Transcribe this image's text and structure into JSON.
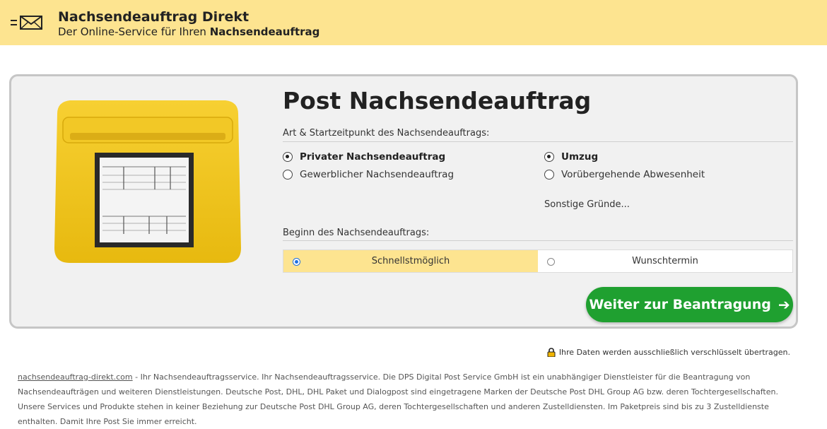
{
  "header": {
    "brand_title": "Nachsendeauftrag Direkt",
    "brand_sub_prefix": "Der Online-Service für Ihren ",
    "brand_sub_bold": "Nachsendeauftrag",
    "logo_icon": "envelope-icon",
    "background": "#fde490"
  },
  "card": {
    "title": "Post Nachsendeauftrag",
    "image": "yellow-mailbox",
    "type_section_label": "Art & Startzeitpunkt des Nachsendeauftrags:",
    "type_options": [
      {
        "label": "Privater Nachsendeauftrag",
        "selected": true
      },
      {
        "label": "Gewerblicher Nachsendeauftrag",
        "selected": false
      }
    ],
    "reason_options": [
      {
        "label": "Umzug",
        "selected": true
      },
      {
        "label": "Vorübergehende Abwesenheit",
        "selected": false
      }
    ],
    "other_reasons": "Sonstige Gründe...",
    "start_section_label": "Beginn des Nachsendeauftrags:",
    "start_options": [
      {
        "label": "Schnellstmöglich",
        "selected": true
      },
      {
        "label": "Wunschtermin",
        "selected": false
      }
    ],
    "cta_label": "Weiter zur Beantragung",
    "cta_color": "#1fa030"
  },
  "secure_note": "Ihre Daten werden ausschließlich verschlüsselt übertragen.",
  "footer": {
    "link_text": "nachsendeauftrag-direkt.com",
    "text": " - Ihr Nachsendeauftragsservice. Ihr Nachsendeauftragsservice. Die DPS Digital Post Service GmbH ist ein unabhängiger Dienstleister für die Beantragung von Nachsendeaufträgen und weiteren Dienstleistungen. Deutsche Post, DHL, DHL Paket und Dialogpost sind eingetragene Marken der Deutsche Post DHL Group AG bzw. deren Tochtergesellschaften. Unsere Services und Produkte stehen in keiner Beziehung zur Deutsche Post DHL Group AG, deren Tochtergesellschaften und anderen Zustelldiensten. Im Paketpreis sind bis zu 3 Zustelldienste enthalten. Damit Ihre Post Sie immer erreicht."
  }
}
